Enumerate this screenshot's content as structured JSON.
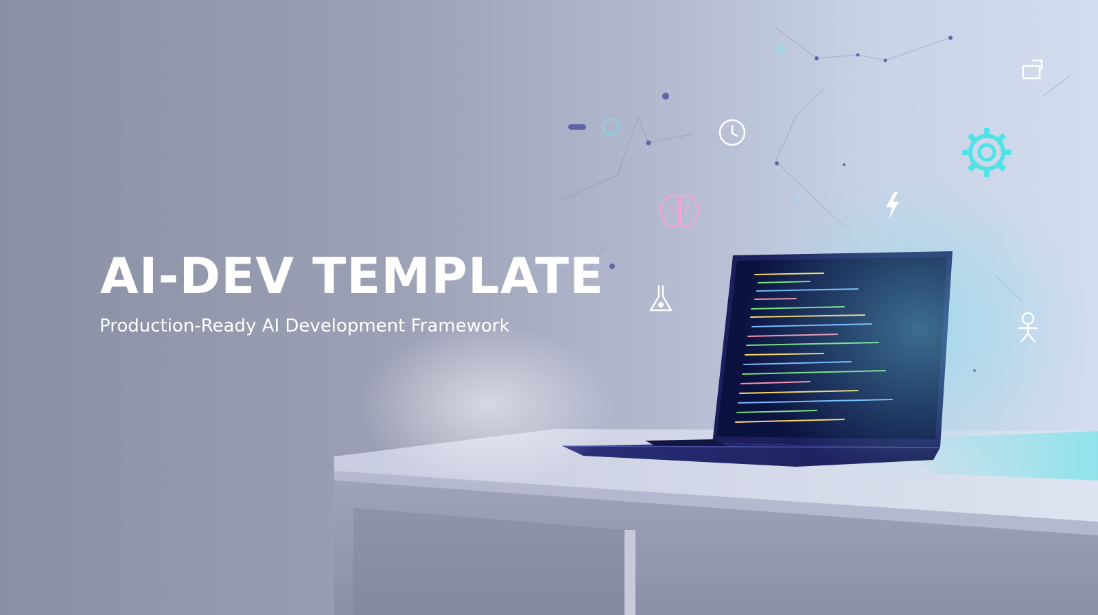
{
  "hero": {
    "title": "AI-DEV TEMPLATE",
    "subtitle": "Production-Ready AI Development Framework"
  },
  "floating_icons": [
    "brain-icon",
    "lightning-icon",
    "gear-icon",
    "clock-icon",
    "robot-icon",
    "flask-icon",
    "expand-icon"
  ],
  "colors": {
    "title_text": "#ffffff",
    "accent_cyan": "#4fe3e6",
    "brain_pink": "#f2a6d6",
    "laptop_body": "#1c1f5c",
    "screen_bg": "#0b1240"
  }
}
